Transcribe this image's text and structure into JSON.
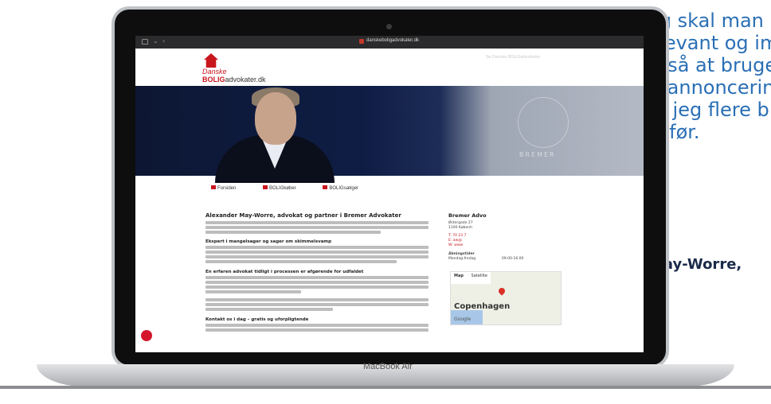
{
  "quote": {
    "line1": "annoncering skal man k",
    "line2": "fremstår relevant og im",
    "line3": "har valgt også at bruge",
    "line4": "Google Ads-annoncerin",
    "line5": "beløb opnår jeg flere b",
    "line6": "nogensinde før.",
    "author": "/ Alexander May-Worre,"
  },
  "laptop": {
    "brand": "MacBook Air"
  },
  "browser": {
    "url": "danskeboligadvokater.dk"
  },
  "site": {
    "logo_line1": "Danske",
    "logo_bolig": "BOLIG",
    "logo_rest": "advokater.dk",
    "header_right": "Se Danske BOLIGadvokater",
    "hero_watermark": "BREMER",
    "nav": [
      "Forsiden",
      "BOLIGkøber",
      "BOLIGsælger"
    ],
    "heading": "Alexander May-Worre, advokat og partner i Bremer Advokater",
    "sub1": "Ekspert i mangelsager og sager om skimmelsvamp",
    "sub2": "En erfaren advokat tidligt i processen er afgørende for udfaldet",
    "sub3": "Kontakt os i dag – gratis og uforpligtende"
  },
  "sidebar": {
    "title": "Bremer Advo",
    "address1": "Østergade 27",
    "address2": "1100 Københ",
    "phone": "T: 70 23 7",
    "email": "E: aw@",
    "web": "W: www",
    "hours_label": "Åbningstider",
    "hours_day": "Mandag-fredag",
    "hours_time": "09.00-16.00"
  },
  "map": {
    "tab_map": "Map",
    "tab_satellite": "Satellite",
    "city": "Copenhagen",
    "logo": "Google"
  },
  "colors": {
    "quote_blue": "#2a6fb5",
    "author_navy": "#1b2a4a",
    "brand_red": "#c8161d"
  }
}
